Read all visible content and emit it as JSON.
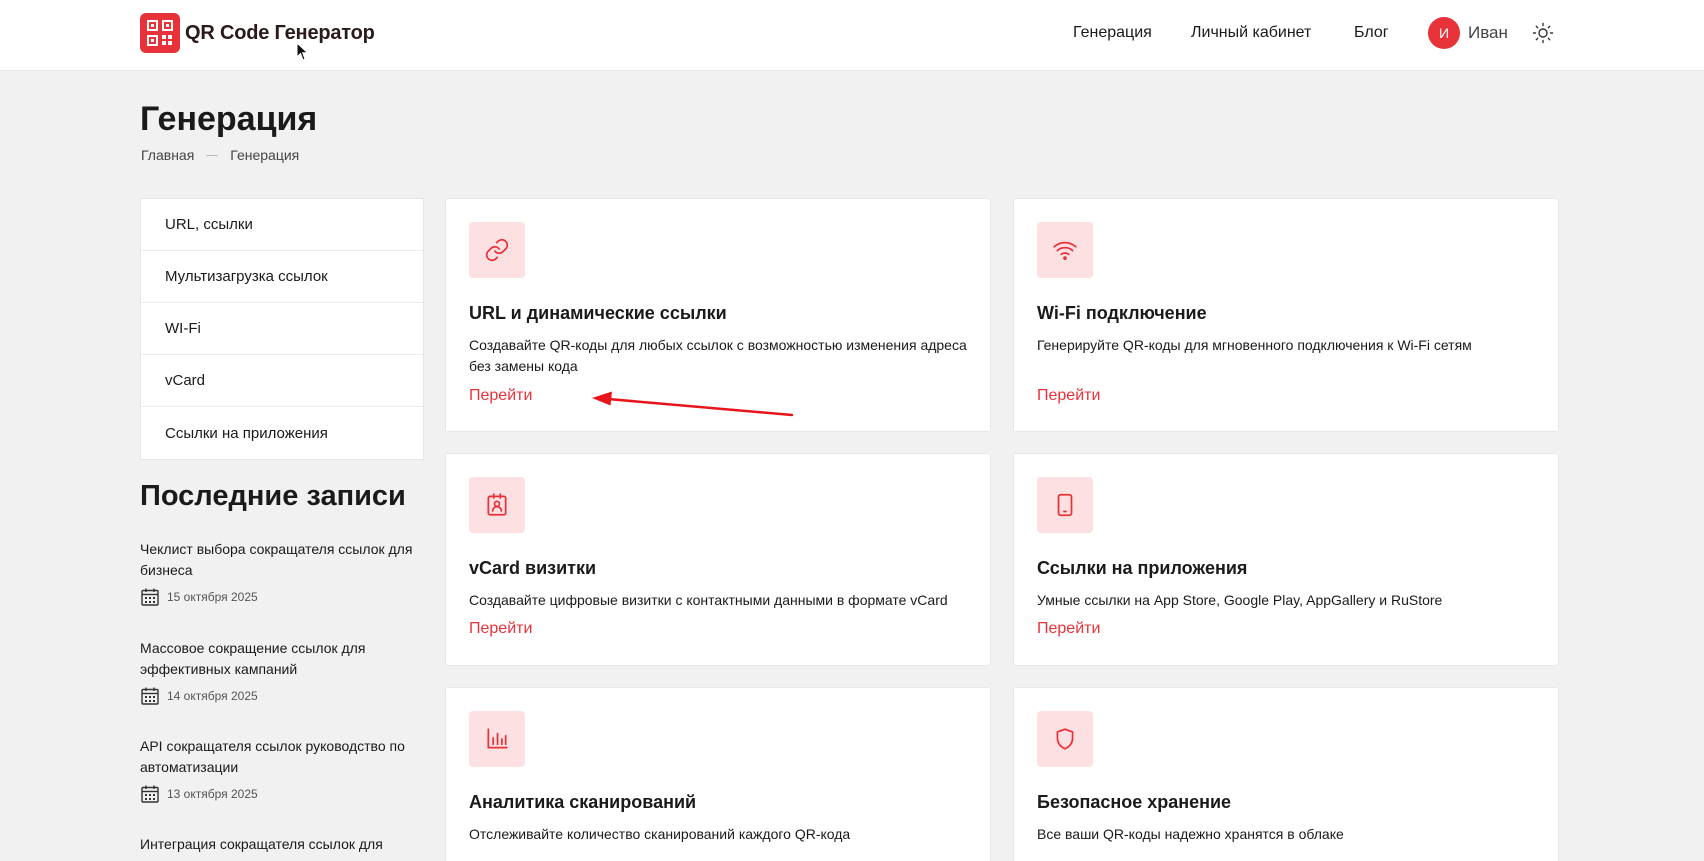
{
  "header": {
    "logo_text": "QR Code Генератор",
    "nav": {
      "generation": "Генерация",
      "cabinet": "Личный кабинет",
      "blog": "Блог"
    },
    "user": {
      "avatar_letter": "И",
      "name": "Иван"
    }
  },
  "page": {
    "title": "Генерация",
    "breadcrumb": [
      "Главная",
      "Генерация"
    ]
  },
  "sidebar": {
    "items": [
      {
        "label": "URL, ссылки"
      },
      {
        "label": "Мультизагрузка ссылок"
      },
      {
        "label": "WI-Fi"
      },
      {
        "label": "vCard"
      },
      {
        "label": "Ссылки на приложения"
      }
    ],
    "recent_title": "Последние записи",
    "posts": [
      {
        "title": "Чеклист выбора сокращателя ссылок для бизнеса",
        "date": "15 октября 2025"
      },
      {
        "title": "Массовое сокращение ссылок для эффективных кампаний",
        "date": "14 октября 2025"
      },
      {
        "title": "API сокращателя ссылок руководство по автоматизации",
        "date": "13 октября 2025"
      },
      {
        "title": "Интеграция сокращателя ссылок для",
        "date": ""
      }
    ]
  },
  "cards": [
    {
      "icon": "link-icon",
      "title": "URL и динамические ссылки",
      "desc": "Создавайте QR-коды для любых ссылок с возможностью изменения адреса без замены кода",
      "link": "Перейти"
    },
    {
      "icon": "wifi-icon",
      "title": "Wi-Fi подключение",
      "desc": "Генерируйте QR-коды для мгновенного подключения к Wi-Fi сетям",
      "link": "Перейти"
    },
    {
      "icon": "contact-card-icon",
      "title": "vCard визитки",
      "desc": "Создавайте цифровые визитки с контактными данными в формате vCard",
      "link": "Перейти"
    },
    {
      "icon": "mobile-phone-icon",
      "title": "Ссылки на приложения",
      "desc": "Умные ссылки на App Store, Google Play, AppGallery и RuStore",
      "link": "Перейти"
    },
    {
      "icon": "bar-chart-icon",
      "title": "Аналитика сканирований",
      "desc": "Отслеживайте количество сканирований каждого QR-кода",
      "link": ""
    },
    {
      "icon": "shield-icon",
      "title": "Безопасное хранение",
      "desc": "Все ваши QR-коды надежно хранятся в облаке",
      "link": ""
    }
  ],
  "colors": {
    "accent": "#e8323a",
    "accent_light": "#fde0e1",
    "background": "#f1f1f1"
  }
}
